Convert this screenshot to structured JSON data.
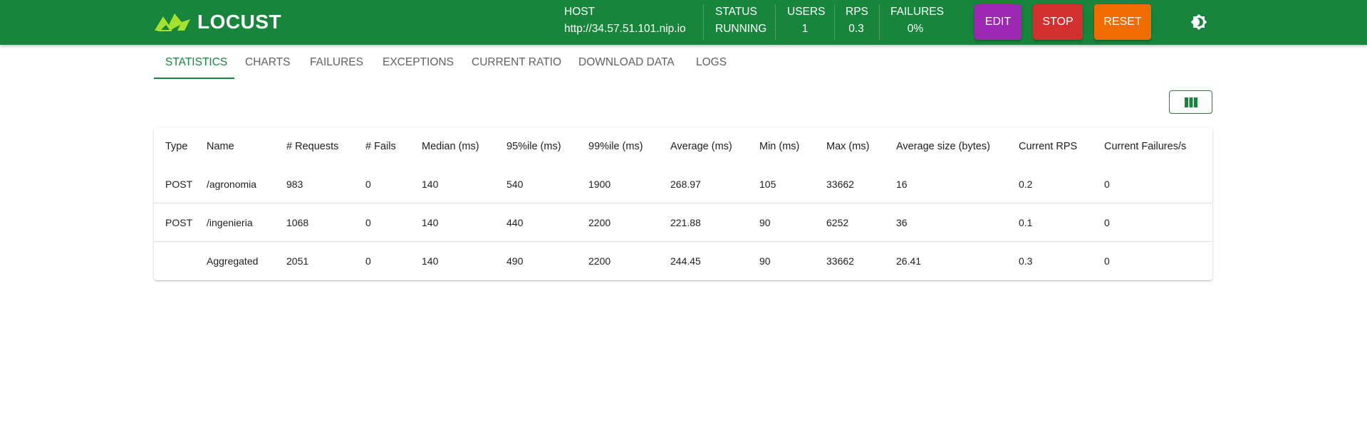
{
  "app": {
    "name": "LOCUST",
    "brand_color": "#17853c",
    "logo_color": "#a4e22e"
  },
  "header": {
    "host": {
      "label": "HOST",
      "value": "http://34.57.51.101.nip.io"
    },
    "status": {
      "label": "STATUS",
      "value": "RUNNING"
    },
    "users": {
      "label": "USERS",
      "value": "1"
    },
    "rps": {
      "label": "RPS",
      "value": "0.3"
    },
    "failures": {
      "label": "FAILURES",
      "value": "0%"
    },
    "buttons": {
      "edit": "EDIT",
      "stop": "STOP",
      "reset": "RESET"
    },
    "button_colors": {
      "edit": "#9c27b0",
      "stop": "#d32f2f",
      "reset": "#ef6c00"
    },
    "theme_icon": "brightness-icon"
  },
  "tabs": [
    {
      "label": "STATISTICS",
      "active": true
    },
    {
      "label": "CHARTS",
      "active": false
    },
    {
      "label": "FAILURES",
      "active": false
    },
    {
      "label": "EXCEPTIONS",
      "active": false
    },
    {
      "label": "CURRENT RATIO",
      "active": false
    },
    {
      "label": "DOWNLOAD DATA",
      "active": false
    },
    {
      "label": "LOGS",
      "active": false
    }
  ],
  "toolbar": {
    "columns_icon": "view-column-icon"
  },
  "table": {
    "headers": [
      "Type",
      "Name",
      "# Requests",
      "# Fails",
      "Median (ms)",
      "95%ile (ms)",
      "99%ile (ms)",
      "Average (ms)",
      "Min (ms)",
      "Max (ms)",
      "Average size (bytes)",
      "Current RPS",
      "Current Failures/s"
    ],
    "rows": [
      [
        "POST",
        "/agronomia",
        "983",
        "0",
        "140",
        "540",
        "1900",
        "268.97",
        "105",
        "33662",
        "16",
        "0.2",
        "0"
      ],
      [
        "POST",
        "/ingenieria",
        "1068",
        "0",
        "140",
        "440",
        "2200",
        "221.88",
        "90",
        "6252",
        "36",
        "0.1",
        "0"
      ],
      [
        "",
        "Aggregated",
        "2051",
        "0",
        "140",
        "490",
        "2200",
        "244.45",
        "90",
        "33662",
        "26.41",
        "0.3",
        "0"
      ]
    ]
  }
}
